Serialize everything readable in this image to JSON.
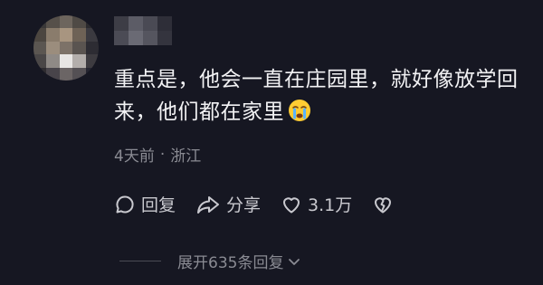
{
  "comment": {
    "text": "重点是，他会一直在庄园里，就好像放学回来，他们都在家里",
    "emoji": "crying-face-emoji"
  },
  "meta": {
    "time": "4天前",
    "separator": "·",
    "location": "浙江"
  },
  "actions": {
    "reply_label": "回复",
    "share_label": "分享",
    "like_count": "3.1万",
    "reply_icon": "comment-bubble-icon",
    "share_icon": "share-arrow-icon",
    "like_icon": "heart-icon",
    "dislike_icon": "broken-heart-icon"
  },
  "replies": {
    "expand_label": "展开635条回复",
    "icon": "chevron-down-icon"
  },
  "colors": {
    "background": "#161722",
    "text": "#f2f2f4",
    "muted": "#8a8b93",
    "action": "#c9c9cf"
  }
}
